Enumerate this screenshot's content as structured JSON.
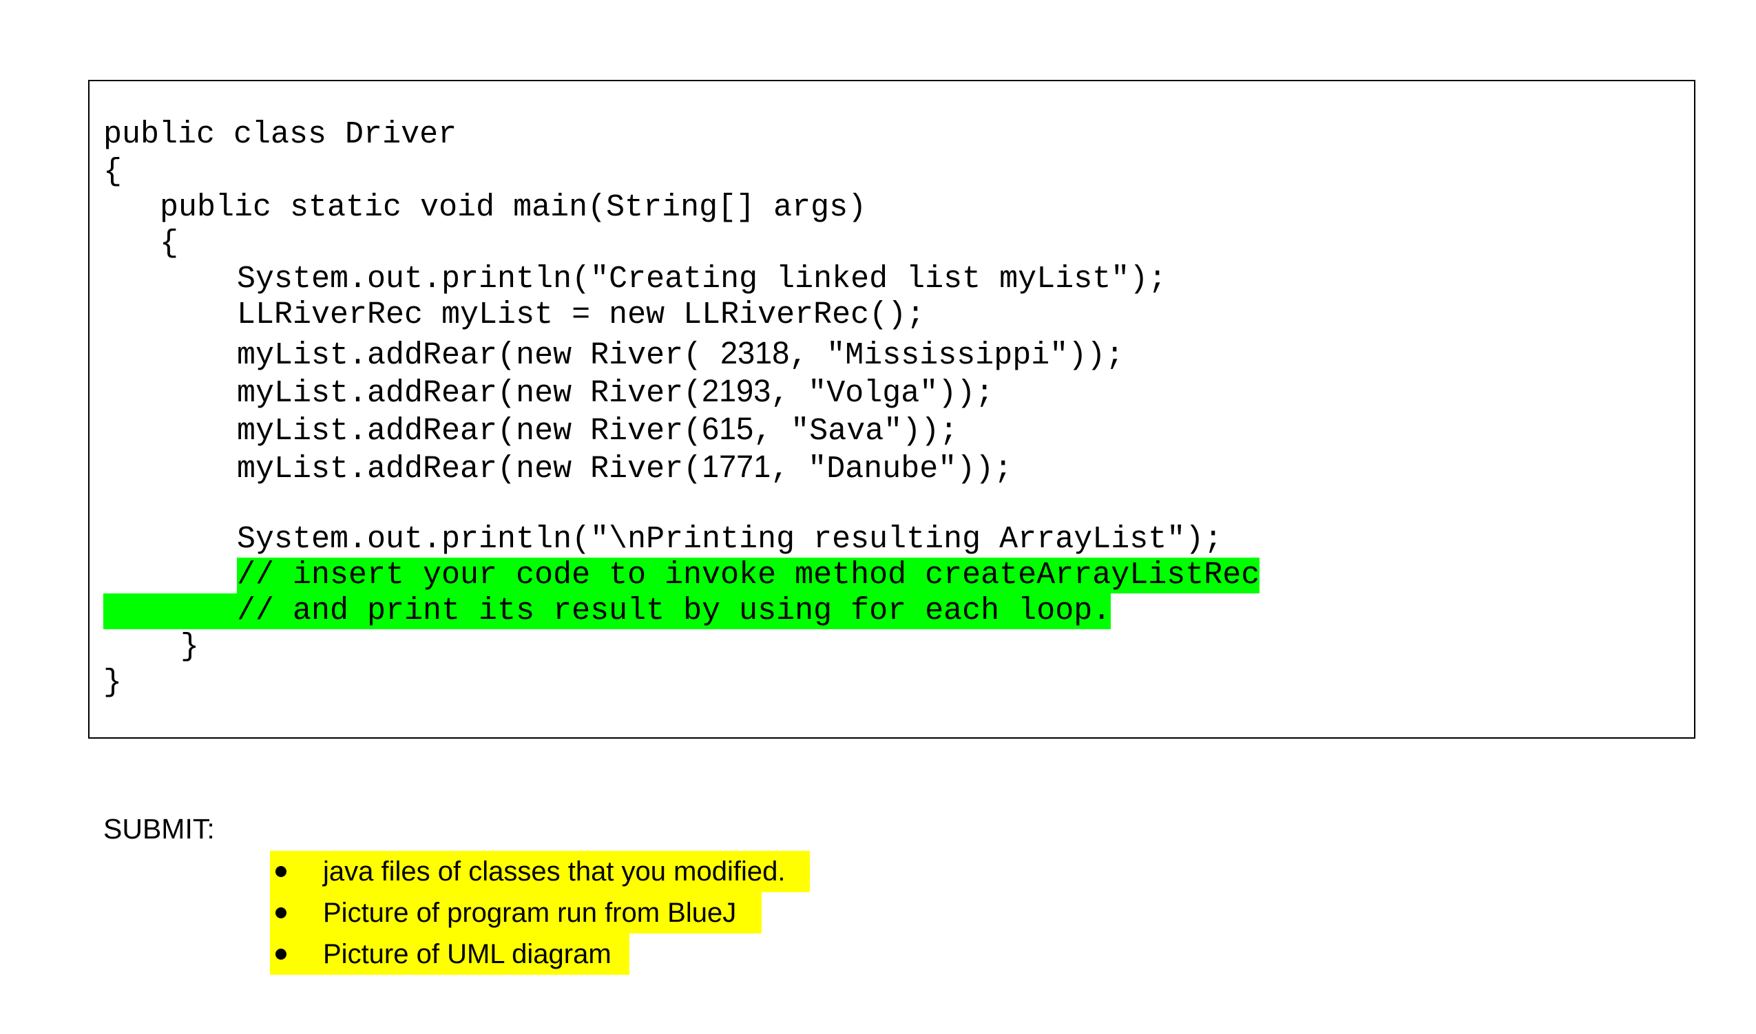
{
  "code": {
    "line1": "public class Driver",
    "line2": "{",
    "line3": "public static void main(String[] args)",
    "line4": "{",
    "line5": "System.out.println(\"Creating linked list myList\");",
    "line6": "LLRiverRec myList = new LLRiverRec();",
    "line7": {
      "prefix": "myList.addRear(new River( ",
      "number": "2318",
      "suffix": ", \"Mississippi\"));"
    },
    "line8": {
      "prefix": "myList.addRear(new River(",
      "number": "2193",
      "suffix": ", \"Volga\"));"
    },
    "line9": {
      "prefix": "myList.addRear(new River(",
      "number": "615",
      "suffix": ", \"Sava\"));"
    },
    "line10": {
      "prefix": "myList.addRear(new River(",
      "number": "1771",
      "suffix": ", \"Danube\"));"
    },
    "line11": "System.out.println(\"\\nPrinting resulting ArrayList\");",
    "comment1": "// insert your code to invoke method createArrayListRec",
    "comment2": "// and print its result by using for each loop.",
    "close_inner": "}",
    "close_outer": "}"
  },
  "submit": {
    "label": "SUBMIT:",
    "items": [
      "java files of classes that you modified.",
      "Picture of program run from BlueJ",
      "Picture of UML diagram"
    ]
  },
  "colors": {
    "comment_highlight": "#00ff00",
    "submit_highlight": "#ffff00"
  }
}
